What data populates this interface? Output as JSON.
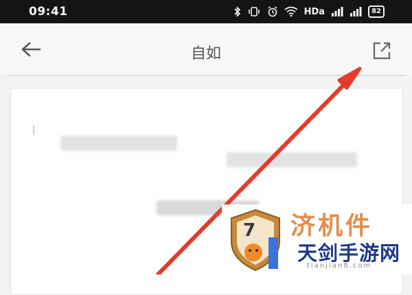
{
  "status_bar": {
    "time": "09:41",
    "network_label": "HDa",
    "battery": "82"
  },
  "header": {
    "title": "自如",
    "back_icon": "arrow-left-icon",
    "open_icon": "open-external-icon"
  },
  "colors": {
    "status_bar_bg": "#141414",
    "page_bg": "#f3f3f3",
    "annotation_arrow": "#e63a2a",
    "watermark_orange": "#e07a2c",
    "watermark_blue": "#1b3a8a"
  },
  "watermark": {
    "line1": "济机件",
    "line2": "天剑手游网",
    "url": "tianjian8.com"
  }
}
